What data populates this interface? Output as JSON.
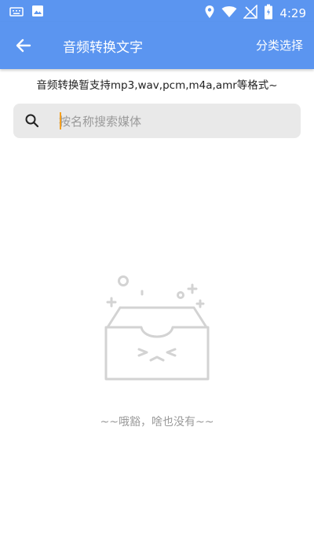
{
  "status_bar": {
    "time": "4:29",
    "left_icons": [
      "keyboard-icon",
      "image-icon"
    ],
    "right_icons": [
      "location-icon",
      "wifi-icon",
      "no-signal-icon",
      "battery-icon"
    ]
  },
  "app_bar": {
    "title": "音频转换文字",
    "action_label": "分类选择",
    "back_icon": "arrow-left-icon",
    "color": "#5b95f0"
  },
  "hint": "音频转换暂支持mp3,wav,pcm,m4a,amr等格式~",
  "search": {
    "placeholder": "按名称搜索媒体",
    "value": "",
    "icon": "search-icon"
  },
  "empty_state": {
    "icon": "empty-box-icon",
    "message": "~~哦豁，啥也没有~~"
  }
}
